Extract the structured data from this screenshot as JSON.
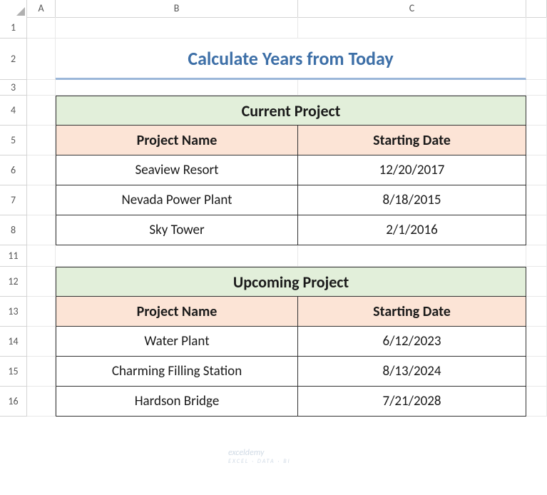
{
  "columns": {
    "a": "A",
    "b": "B",
    "c": "C"
  },
  "row_labels": [
    "1",
    "2",
    "3",
    "4",
    "5",
    "6",
    "7",
    "8",
    "11",
    "12",
    "13",
    "14",
    "15",
    "16"
  ],
  "title": "Calculate Years from Today",
  "table1": {
    "title": "Current Project",
    "header_name": "Project Name",
    "header_date": "Starting Date",
    "rows": [
      {
        "name": "Seaview Resort",
        "date": "12/20/2017"
      },
      {
        "name": "Nevada Power Plant",
        "date": "8/18/2015"
      },
      {
        "name": "Sky Tower",
        "date": "2/1/2016"
      }
    ]
  },
  "table2": {
    "title": "Upcoming Project",
    "header_name": "Project Name",
    "header_date": "Starting Date",
    "rows": [
      {
        "name": "Water Plant",
        "date": "6/12/2023"
      },
      {
        "name": "Charming Filling Station",
        "date": "8/13/2024"
      },
      {
        "name": "Hardson Bridge",
        "date": "7/21/2028"
      }
    ]
  },
  "watermark": {
    "main": "exceldemy",
    "sub": "EXCEL · DATA · BI"
  }
}
